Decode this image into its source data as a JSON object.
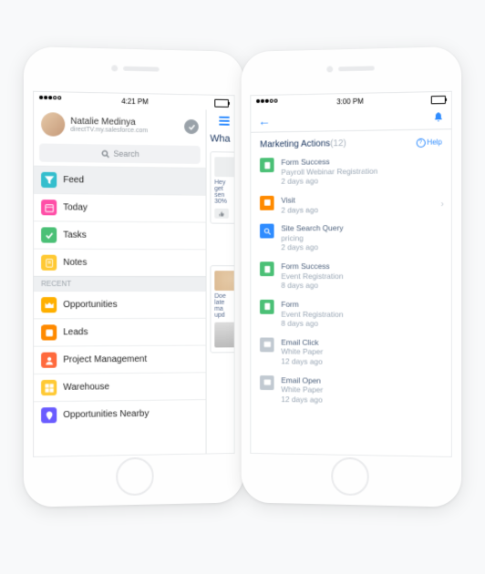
{
  "phone_left": {
    "time": "4:21 PM",
    "profile": {
      "name": "Natalie Medinya",
      "sub": "directTV.my.salesforce.com"
    },
    "search_placeholder": "Search",
    "nav": [
      {
        "label": "Feed",
        "color": "#34becd",
        "icon": "funnel",
        "selected": true
      },
      {
        "label": "Today",
        "color": "#ff4fa7",
        "icon": "calendar"
      },
      {
        "label": "Tasks",
        "color": "#4bc076",
        "icon": "check"
      },
      {
        "label": "Notes",
        "color": "#ffc933",
        "icon": "note"
      }
    ],
    "recent_header": "RECENT",
    "recent": [
      {
        "label": "Opportunities",
        "color": "#ffb000",
        "icon": "crown"
      },
      {
        "label": "Leads",
        "color": "#ff8a00",
        "icon": "box"
      },
      {
        "label": "Project Management",
        "color": "#ff6a3d",
        "icon": "user"
      },
      {
        "label": "Warehouse",
        "color": "#ffc933",
        "icon": "grid"
      },
      {
        "label": "Opportunities Nearby",
        "color": "#6a5cff",
        "icon": "pin"
      }
    ],
    "peek": {
      "header": "Wha",
      "card1": [
        "Hey",
        "get",
        "sen",
        "30%"
      ],
      "card2": [
        "Doe",
        "late",
        "ma",
        "upd"
      ]
    }
  },
  "phone_right": {
    "time": "3:00 PM",
    "section_title": "Marketing Actions",
    "section_count": "(12)",
    "help_label": "Help",
    "items": [
      {
        "title": "Form Success",
        "detail": "Payroll Webinar Registration",
        "age": "2 days ago",
        "color": "#4bc076",
        "icon": "doc",
        "caret": false
      },
      {
        "title": "Visit",
        "detail": "",
        "age": "2 days ago",
        "color": "#ff8a00",
        "icon": "square",
        "caret": true
      },
      {
        "title": "Site Search Query",
        "detail": "pricing",
        "age": "2 days ago",
        "color": "#2f8cff",
        "icon": "search",
        "caret": false
      },
      {
        "title": "Form Success",
        "detail": "Event Registration",
        "age": "8 days ago",
        "color": "#4bc076",
        "icon": "doc",
        "caret": false
      },
      {
        "title": "Form",
        "detail": "Event Registration",
        "age": "8 days ago",
        "color": "#4bc076",
        "icon": "doc",
        "caret": false
      },
      {
        "title": "Email Click",
        "detail": "White Paper",
        "age": "12 days ago",
        "color": "#c1c9d1",
        "icon": "mail",
        "caret": false
      },
      {
        "title": "Email Open",
        "detail": "White Paper",
        "age": "12 days ago",
        "color": "#c1c9d1",
        "icon": "mail",
        "caret": false
      }
    ]
  }
}
